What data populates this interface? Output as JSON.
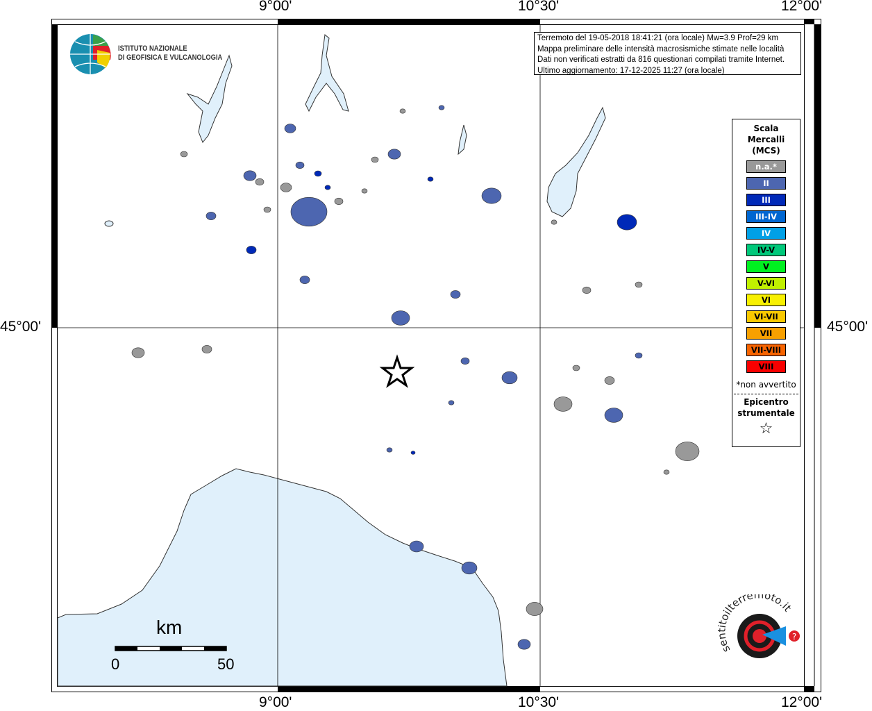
{
  "axes": {
    "lon_ticks": [
      "9°00'",
      "10°30'",
      "12°00'"
    ],
    "lat_ticks": [
      "45°00'"
    ]
  },
  "info": {
    "line1": "Terremoto del 19-05-2018 18:41:21 (ora locale) Mw=3.9 Prof=29 km",
    "line2": "Mappa preliminare delle intensità macrosismiche stimate nelle località",
    "line3": "Dati non verificati estratti da 816 questionari compilati tramite Internet.",
    "line4": "Ultimo aggiornamento: 17-12-2025 11:27 (ora locale)"
  },
  "logo_ingv": {
    "line1": "ISTITUTO NAZIONALE",
    "line2": "DI GEOFISICA E VULCANOLOGIA"
  },
  "logo_hst": {
    "text": "www.haisentitoilterremoto.it"
  },
  "legend": {
    "title1": "Scala",
    "title2": "Mercalli",
    "title3": "(MCS)",
    "classes": [
      {
        "label": "n.a.*",
        "color": "#999999",
        "text_color": "#ffffff"
      },
      {
        "label": "II",
        "color": "#4d66b0",
        "text_color": "#ffffff"
      },
      {
        "label": "III",
        "color": "#0029b8",
        "text_color": "#ffffff"
      },
      {
        "label": "III-IV",
        "color": "#0066d1",
        "text_color": "#ffffff"
      },
      {
        "label": "IV",
        "color": "#00a0e6",
        "text_color": "#ffffff"
      },
      {
        "label": "IV-V",
        "color": "#00c87a",
        "text_color": "#000000"
      },
      {
        "label": "V",
        "color": "#00f020",
        "text_color": "#000000"
      },
      {
        "label": "V-VI",
        "color": "#c0f000",
        "text_color": "#000000"
      },
      {
        "label": "VI",
        "color": "#f8f000",
        "text_color": "#000000"
      },
      {
        "label": "VI-VII",
        "color": "#f8c800",
        "text_color": "#000000"
      },
      {
        "label": "VII",
        "color": "#f8a000",
        "text_color": "#000000"
      },
      {
        "label": "VII-VIII",
        "color": "#f86400",
        "text_color": "#000000"
      },
      {
        "label": "VIII",
        "color": "#f80000",
        "text_color": "#000000"
      }
    ],
    "note": "*non avvertito",
    "epicenter1": "Epicentro",
    "epicenter2": "strumentale"
  },
  "scalebar": {
    "unit": "km",
    "start": "0",
    "end": "50"
  },
  "colors": {
    "sea": "#e0f0fb",
    "frame": "#000000"
  }
}
